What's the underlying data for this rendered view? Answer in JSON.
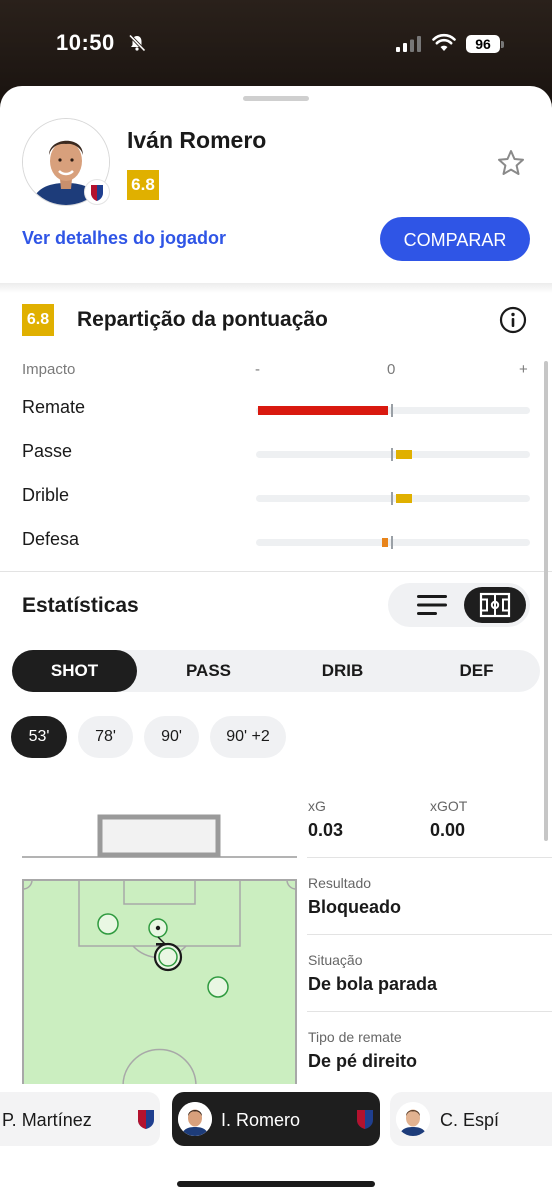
{
  "status": {
    "time": "10:50",
    "battery": "96"
  },
  "player": {
    "name": "Iván Romero",
    "rating": "6.8",
    "details_link": "Ver detalhes do jogador",
    "compare_label": "COMPARAR"
  },
  "breakdown": {
    "rating": "6.8",
    "title": "Repartição da pontuação",
    "impact_label": "Impacto",
    "axis": {
      "minus": "-",
      "zero": "0",
      "plus": "+"
    },
    "categories": [
      {
        "label": "Remate",
        "impact": -1.0,
        "color": "#d9190f"
      },
      {
        "label": "Passe",
        "impact": 0.12,
        "color": "#e0b000"
      },
      {
        "label": "Drible",
        "impact": 0.12,
        "color": "#e0b000"
      },
      {
        "label": "Defesa",
        "impact": -0.05,
        "color": "#e8841a"
      }
    ]
  },
  "stats": {
    "title": "Estatísticas",
    "tabs": [
      "SHOT",
      "PASS",
      "DRIB",
      "DEF"
    ],
    "active_tab": "SHOT",
    "minutes": [
      "53'",
      "78'",
      "90'",
      "90' +2"
    ],
    "active_minute": "53'",
    "pitch_color": "#cbeec0",
    "xg": {
      "label": "xG",
      "value": "0.03"
    },
    "xgot": {
      "label": "xGOT",
      "value": "0.00"
    },
    "result": {
      "label": "Resultado",
      "value": "Bloqueado"
    },
    "situation": {
      "label": "Situação",
      "value": "De bola parada"
    },
    "shot_type": {
      "label": "Tipo de remate",
      "value": "De pé direito"
    }
  },
  "player_bar": [
    {
      "name": "P. Martínez"
    },
    {
      "name": "I. Romero"
    },
    {
      "name": "C. Espí"
    }
  ]
}
